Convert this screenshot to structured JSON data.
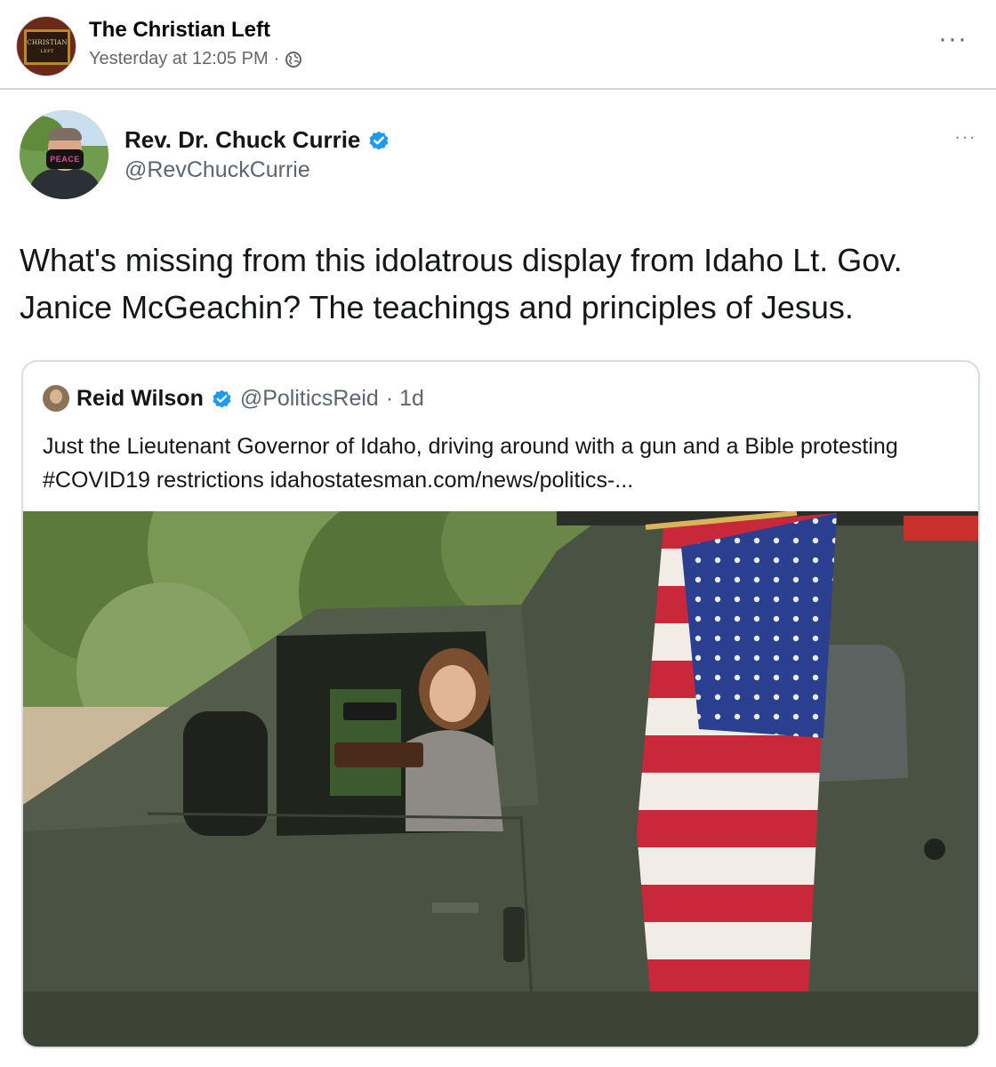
{
  "post": {
    "page_name": "The Christian Left",
    "timestamp": "Yesterday at 12:05 PM",
    "separator": "·",
    "more": "···",
    "avatar_text": [
      "CHRISTIAN",
      "LEFT"
    ],
    "privacy_icon": "globe-icon"
  },
  "tweet": {
    "author_name": "Rev. Dr. Chuck Currie",
    "author_handle": "@RevChuckCurrie",
    "verified_icon": "verified-badge-icon",
    "more": "···",
    "avatar_mask_text": "PEACE",
    "text": "What's missing from this idolatrous display from Idaho Lt. Gov. Janice McGeachin? The teachings and principles of Jesus."
  },
  "quoted_tweet": {
    "author_name": "Reid Wilson",
    "author_handle": "@PoliticsReid",
    "age": "· 1d",
    "text": "Just the Lieutenant Governor of Idaho, driving around with a gun and a Bible protesting #COVID19 restrictions idahostatesman.com/news/politics-...",
    "photo_icon": "photo-woman-in-van-with-flag"
  },
  "colors": {
    "verified_blue": "#1d9bf0",
    "van_green": "#4a5243",
    "flag_red": "#c8283a",
    "flag_blue": "#2a3f8f"
  }
}
